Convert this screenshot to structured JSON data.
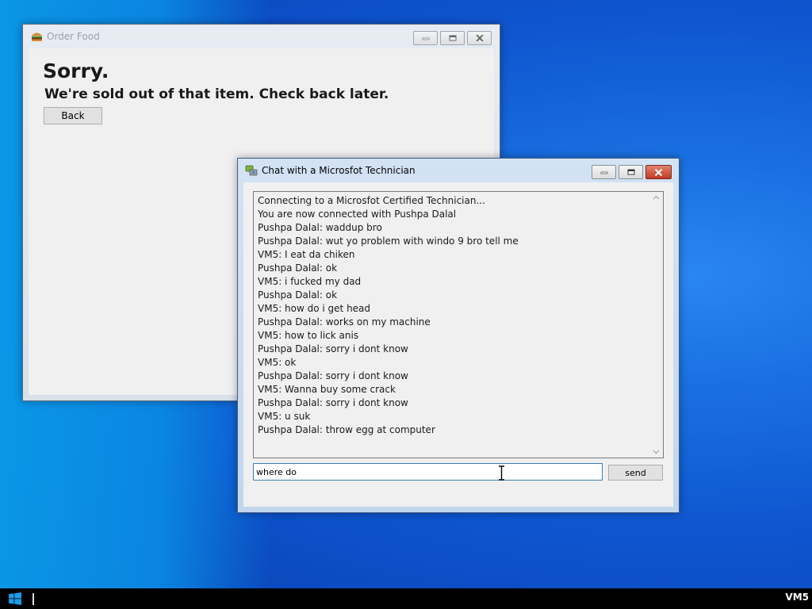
{
  "order_window": {
    "title": "Order Food",
    "icon": "burger-icon",
    "heading": "Sorry.",
    "message": "We're sold out of that item. Check back later.",
    "back_label": "Back"
  },
  "chat_window": {
    "title": "Chat with a Microsfot Technician",
    "icon": "chat-app-icon",
    "messages": [
      "Connecting to a Microsfot Certified Technician...",
      "You are now connected with Pushpa Dalal",
      "Pushpa Dalal: waddup bro",
      "Pushpa Dalal: wut yo problem with windo 9 bro tell me",
      "VM5: I eat da chiken",
      "Pushpa Dalal: ok",
      "VM5: i fucked my dad",
      "Pushpa Dalal: ok",
      "VM5: how do i get head",
      "Pushpa Dalal: works on my machine",
      "VM5: how to lick anis",
      "Pushpa Dalal: sorry i dont know",
      "VM5: ok",
      "Pushpa Dalal: sorry i dont know",
      "VM5: Wanna buy some crack",
      "Pushpa Dalal: sorry i dont know",
      "VM5: u suk",
      "Pushpa Dalal: throw egg at computer"
    ],
    "input_value": "where do ",
    "send_label": "send"
  },
  "taskbar": {
    "start_icon": "windows-logo-icon",
    "user_label": "VM5"
  },
  "colors": {
    "desktop_blue": "#0e55cf",
    "close_button_red": "#c23a22",
    "taskbar": "#000000"
  }
}
